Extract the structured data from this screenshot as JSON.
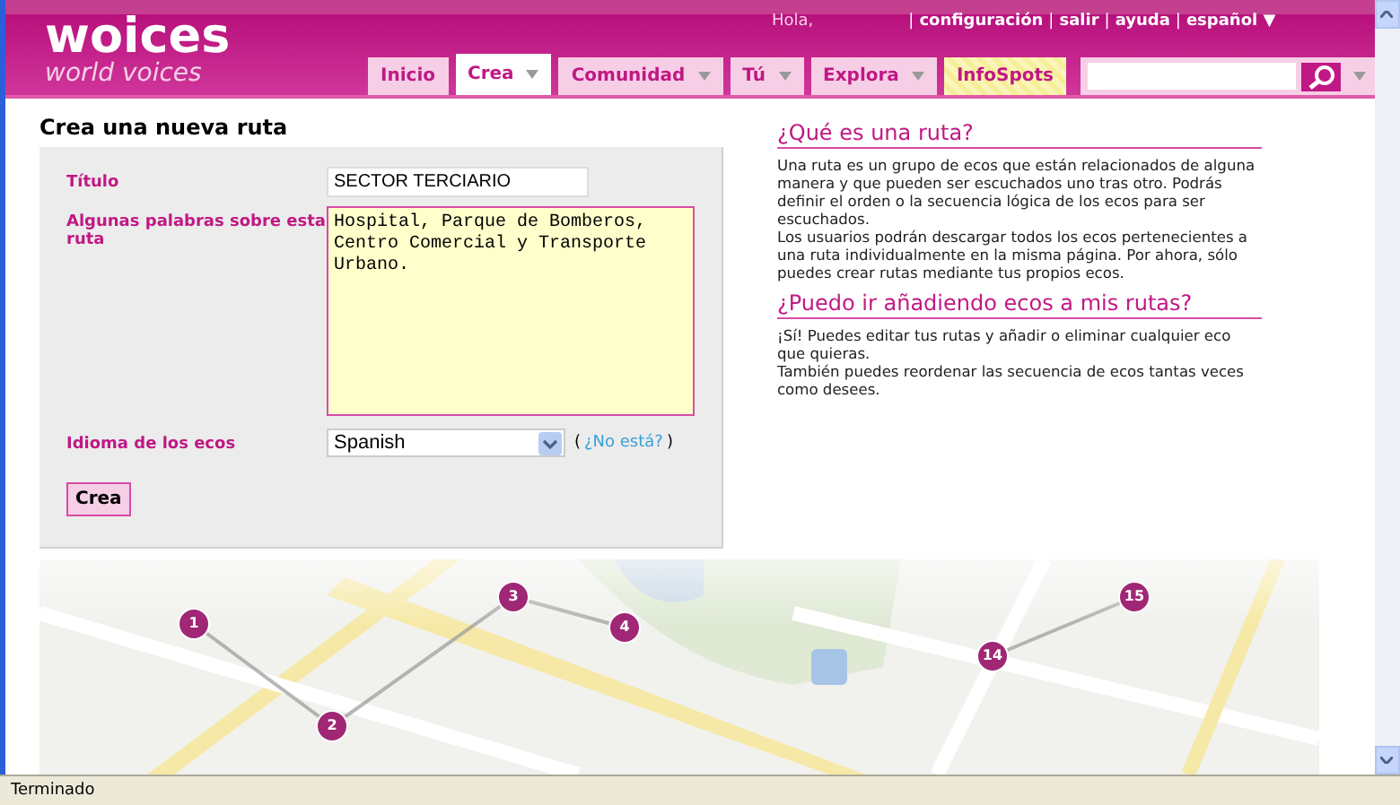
{
  "header": {
    "logo": {
      "title": "woices",
      "subtitle": "world voices"
    },
    "greeting": "Hola,",
    "separator": "|",
    "links": [
      "configuración",
      "salir",
      "ayuda",
      "español ▼"
    ],
    "tabs": [
      {
        "label": "Inicio",
        "selected": false,
        "dropdown": false,
        "kind": "tab"
      },
      {
        "label": "Crea",
        "selected": true,
        "dropdown": true,
        "kind": "tab"
      },
      {
        "label": "Comunidad",
        "selected": false,
        "dropdown": true,
        "kind": "tab"
      },
      {
        "label": "Tú",
        "selected": false,
        "dropdown": true,
        "kind": "tab"
      },
      {
        "label": "Explora",
        "selected": false,
        "dropdown": true,
        "kind": "tab"
      },
      {
        "label": "InfoSpots",
        "selected": false,
        "dropdown": false,
        "kind": "highlight"
      }
    ]
  },
  "form": {
    "title": "Crea una nueva ruta",
    "fields": [
      {
        "kind": "text",
        "label": "Título",
        "value": "SECTOR TERCIARIO"
      },
      {
        "kind": "textarea",
        "label": "Algunas palabras sobre esta ruta",
        "value": "Hospital, Parque de Bomberos, Centro Comercial y Transporte Urbano."
      },
      {
        "kind": "select",
        "label": "Idioma de los ecos",
        "value": "Spanish",
        "help_open": "(",
        "help_link": "¿No está?",
        "help_close": ")"
      }
    ],
    "button": "Crea"
  },
  "help": [
    {
      "heading": "¿Qué es una ruta?",
      "paragraphs": [
        "Una ruta es un grupo de ecos que están relacionados de alguna manera y que pueden ser escuchados uno tras otro. Podrás definir el orden o la secuencia lógica de los ecos para ser escuchados.",
        "Los usuarios podrán descargar todos los ecos pertenecientes a una ruta individualmente en la misma página. Por ahora, sólo puedes crear rutas mediante tus propios ecos."
      ]
    },
    {
      "heading": "¿Puedo ir añadiendo ecos a mis rutas?",
      "paragraphs": [
        "¡Sí! Puedes editar tus rutas y añadir o eliminar cualquier eco que quieras.",
        "También puedes reordenar las secuencia de ecos tantas veces como desees."
      ]
    }
  ],
  "map": {
    "pins": [
      {
        "label": "1"
      },
      {
        "label": "2"
      },
      {
        "label": "3"
      },
      {
        "label": "4"
      },
      {
        "label": "14"
      },
      {
        "label": "15"
      }
    ]
  },
  "status_bar": {
    "text": "Terminado"
  }
}
